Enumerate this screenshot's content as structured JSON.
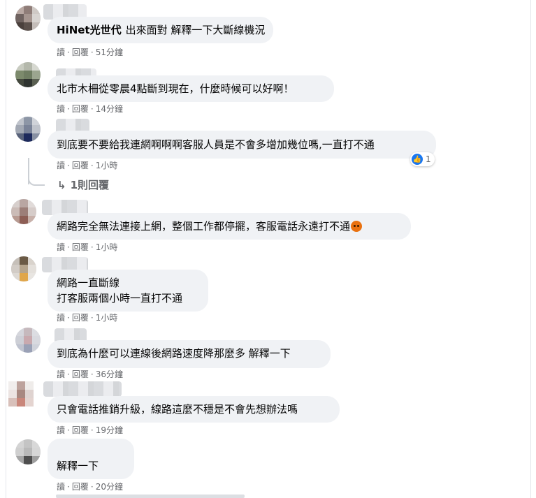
{
  "comments": [
    {
      "author": "HiNet光世代",
      "text": "出來面對 解釋一下大斷線機況",
      "read": "讀",
      "reply": "回覆",
      "time": "51分鐘"
    },
    {
      "author": "",
      "text": "北市木柵從零晨4點斷到現在，什麼時候可以好啊！",
      "read": "讀",
      "reply": "回覆",
      "time": "14分鐘"
    },
    {
      "author": "",
      "text": "到底要不要給我連網啊啊啊客服人員是不會多增加幾位嗎,一直打不通",
      "read": "讀",
      "reply": "回覆",
      "time": "1小時",
      "reaction": {
        "icon": "like-icon",
        "count": "1"
      }
    },
    {
      "author": "",
      "text": "網路完全無法連接上網，整個工作都停擺，客服電話永遠打不通",
      "read": "讀",
      "reply": "回覆",
      "time": "1小時",
      "emoji": "angry-face-icon"
    },
    {
      "author": "",
      "text": "網路一直斷線\n打客服兩個小時一直打不通",
      "read": "讀",
      "reply": "回覆",
      "time": "1小時"
    },
    {
      "author": "",
      "text": "到底為什麼可以連線後網路速度降那麼多 解釋一下",
      "read": "讀",
      "reply": "回覆",
      "time": "36分鐘"
    },
    {
      "author": "",
      "text": "只會電話推銷升級，線路這麼不穩是不會先想辦法嗎",
      "read": "讀",
      "reply": "回覆",
      "time": "19分鐘"
    },
    {
      "author": "",
      "text": "解釋一下",
      "read": "讀",
      "reply": "回覆",
      "time": "20分鐘"
    }
  ],
  "replies_link": "1則回覆",
  "colors": {
    "bubble": "#f0f2f5",
    "meta": "#65676b",
    "like": "#1877f2"
  }
}
